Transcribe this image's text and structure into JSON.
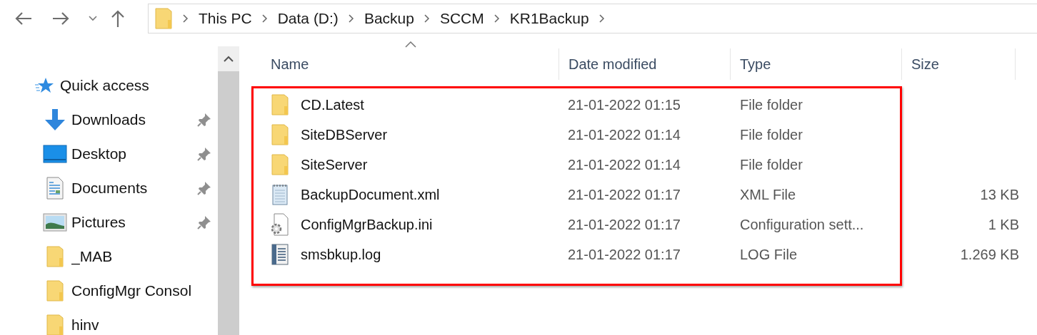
{
  "navigation": {
    "buttons": [
      {
        "kind": "back"
      },
      {
        "kind": "forward"
      },
      {
        "kind": "recent"
      },
      {
        "kind": "up"
      }
    ]
  },
  "address_bar": {
    "path": [
      "This PC",
      "Data (D:)",
      "Backup",
      "SCCM",
      "KR1Backup"
    ]
  },
  "sidebar": {
    "items": [
      {
        "label": "Quick access",
        "kind": "star",
        "pinned": false,
        "children": [
          {
            "label": "Downloads",
            "kind": "download",
            "pinned": true
          },
          {
            "label": "Desktop",
            "kind": "desktop",
            "pinned": true
          },
          {
            "label": "Documents",
            "kind": "document",
            "pinned": true
          },
          {
            "label": "Pictures",
            "kind": "pictures",
            "pinned": true
          },
          {
            "label": "_MAB",
            "kind": "folder",
            "pinned": false
          },
          {
            "label": "ConfigMgr Consol",
            "kind": "folder",
            "pinned": false
          },
          {
            "label": "hinv",
            "kind": "folder",
            "pinned": false
          }
        ]
      }
    ]
  },
  "file_list": {
    "highlighted": true,
    "columns": [
      {
        "label": "Name",
        "sorted": true
      },
      {
        "label": "Date modified",
        "sorted": false
      },
      {
        "label": "Type",
        "sorted": false
      },
      {
        "label": "Size",
        "sorted": false
      }
    ],
    "rows": [
      {
        "kind": "folder",
        "name": "CD.Latest",
        "date_modified": "21-01-2022 01:15",
        "type": "File folder"
      },
      {
        "kind": "folder",
        "name": "SiteDBServer",
        "date_modified": "21-01-2022 01:14",
        "type": "File folder"
      },
      {
        "kind": "folder",
        "name": "SiteServer",
        "date_modified": "21-01-2022 01:14",
        "type": "File folder"
      },
      {
        "kind": "xml",
        "name": "BackupDocument.xml",
        "date_modified": "21-01-2022 01:17",
        "type": "XML File",
        "size": "13 KB"
      },
      {
        "kind": "ini",
        "name": "ConfigMgrBackup.ini",
        "date_modified": "21-01-2022 01:17",
        "type": "Configuration sett...",
        "size": "1 KB"
      },
      {
        "kind": "log",
        "name": "smsbkup.log",
        "date_modified": "21-01-2022 01:17",
        "type": "LOG File",
        "size": "1.269 KB"
      }
    ]
  }
}
